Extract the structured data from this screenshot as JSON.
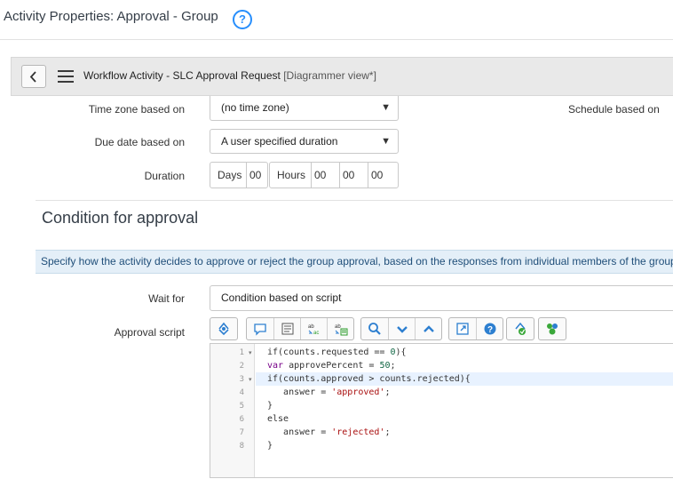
{
  "page": {
    "title": "Activity Properties: Approval - Group",
    "help_symbol": "?"
  },
  "form_header": {
    "title": "Workflow Activity - SLC Approval Request",
    "view_label": "[Diagrammer view*]"
  },
  "fields": {
    "timezone": {
      "label": "Time zone based on",
      "value": "(no time zone)"
    },
    "schedule": {
      "label": "Schedule based on"
    },
    "due_date": {
      "label": "Due date based on",
      "value": "A user specified duration"
    },
    "duration": {
      "label": "Duration",
      "days_label": "Days",
      "days_value": "00",
      "hours_label": "Hours",
      "hours_value": "00",
      "minutes_value": "00",
      "seconds_value": "00"
    }
  },
  "section": {
    "title": "Condition for approval",
    "info": "Specify how the activity decides to approve or reject the group approval, based on the responses from individual members of the group."
  },
  "wait_for": {
    "label": "Wait for",
    "value": "Condition based on script"
  },
  "script": {
    "label": "Approval script",
    "toolbar_icons": [
      "toggle-syntax-icon",
      "comment-icon",
      "format-code-icon",
      "replace-icon",
      "replace-all-icon",
      "search-icon",
      "expand-down-icon",
      "collapse-up-icon",
      "fullscreen-icon",
      "help-icon",
      "script-debug-icon",
      "script-tree-icon"
    ],
    "line_numbers": [
      "1",
      "2",
      "3",
      "4",
      "5",
      "6",
      "7",
      "8"
    ],
    "lines": [
      "if(counts.requested == 0){",
      "var approvePercent = 50;",
      "if(counts.approved > counts.rejected){",
      "   answer = 'approved';",
      "}",
      "else",
      "   answer = 'rejected';",
      "}"
    ],
    "active_line": 3
  },
  "colors": {
    "accent": "#278efc",
    "info_bg": "#e4eff8",
    "info_text": "#1f4e79",
    "keyword": "#770088",
    "string": "#aa1111",
    "number": "#116644"
  }
}
